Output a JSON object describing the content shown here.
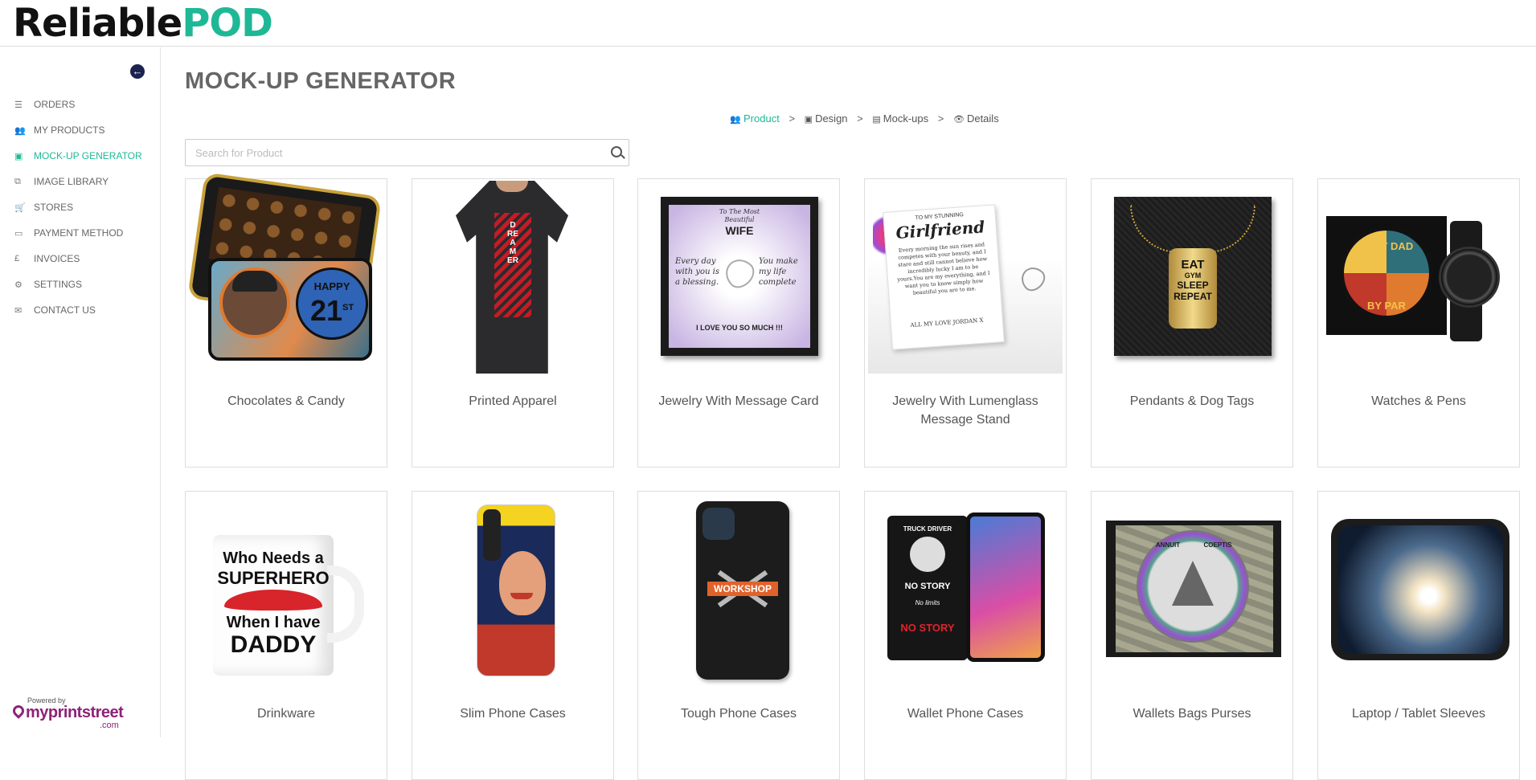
{
  "brand": {
    "part1": "Reliable",
    "part2": "POD"
  },
  "sidebar": {
    "items": [
      {
        "label": "ORDERS",
        "icon": "list-icon",
        "glyph": "☰",
        "active": false
      },
      {
        "label": "MY PRODUCTS",
        "icon": "users-icon",
        "glyph": "👥",
        "active": false
      },
      {
        "label": "MOCK-UP GENERATOR",
        "icon": "image-icon",
        "glyph": "▣",
        "active": true
      },
      {
        "label": "IMAGE LIBRARY",
        "icon": "copy-icon",
        "glyph": "⧉",
        "active": false
      },
      {
        "label": "STORES",
        "icon": "cart-icon",
        "glyph": "🛒",
        "active": false
      },
      {
        "label": "PAYMENT METHOD",
        "icon": "credit-card-icon",
        "glyph": "▭",
        "active": false
      },
      {
        "label": "INVOICES",
        "icon": "pound-icon",
        "glyph": "£",
        "active": false
      },
      {
        "label": "SETTINGS",
        "icon": "gear-icon",
        "glyph": "⚙",
        "active": false
      },
      {
        "label": "CONTACT US",
        "icon": "envelope-icon",
        "glyph": "✉",
        "active": false
      }
    ],
    "powered_by": "Powered by",
    "powered_brand": "myprintstreet",
    "powered_tld": ".com"
  },
  "main": {
    "title": "MOCK-UP GENERATOR",
    "breadcrumb": [
      {
        "label": "Product",
        "icon": "users-icon",
        "glyph": "👥",
        "active": true
      },
      {
        "label": "Design",
        "icon": "image-icon",
        "glyph": "▣",
        "active": false
      },
      {
        "label": "Mock-ups",
        "icon": "file-image-icon",
        "glyph": "▤",
        "active": false
      },
      {
        "label": "Details",
        "icon": "eye-icon",
        "glyph": "👁",
        "active": false
      }
    ],
    "search_placeholder": "Search for Product",
    "products": [
      {
        "label": "Chocolates & Candy",
        "art": {
          "top": "HAPPY",
          "num": "21",
          "sup": "ST"
        }
      },
      {
        "label": "Printed Apparel",
        "art": {
          "word": "DREAMER"
        }
      },
      {
        "label": "Jewelry With Message Card",
        "art": {
          "l1": "To The Most",
          "l2": "Beautiful",
          "l3": "WIFE",
          "left": "Every day with you is a blessing.",
          "right": "You make my life complete",
          "bottom": "I LOVE YOU SO MUCH !!!"
        }
      },
      {
        "label": "Jewelry With Lumenglass Message Stand",
        "art": {
          "l1": "TO MY STUNNING",
          "l2": "Girlfriend",
          "body": "Every morning the sun rises and competes with your beauty, and I stare and still cannot believe how incredibly lucky I am to be yours.You are my everything, and I want you to know simply how beautiful you are to me.",
          "sign": "ALL MY LOVE JORDAN X"
        }
      },
      {
        "label": "Pendants & Dog Tags",
        "art": {
          "l1": "EAT",
          "l2": "GYM",
          "l3": "SLEEP",
          "l4": "REPEAT"
        }
      },
      {
        "label": "Watches & Pens",
        "art": {
          "l1": "BEST DAD",
          "l2": "BY PAR"
        }
      },
      {
        "label": "Drinkware",
        "art": {
          "l1": "Who Needs a",
          "l2": "SUPERHERO",
          "l3": "When I have",
          "l4": "DADDY"
        }
      },
      {
        "label": "Slim Phone Cases",
        "art": {}
      },
      {
        "label": "Tough Phone Cases",
        "art": {
          "l1": "WORKSHOP"
        }
      },
      {
        "label": "Wallet Phone Cases",
        "art": {
          "l1": "TRUCK DRIVER",
          "l2": "NO STORY",
          "l3": "No limits",
          "l4": "NO STORY"
        }
      },
      {
        "label": "Wallets Bags Purses",
        "art": {
          "l1": "ANNUIT",
          "l2": "COEPTIS"
        }
      },
      {
        "label": "Laptop / Tablet Sleeves",
        "art": {}
      }
    ]
  },
  "colors": {
    "accent": "#1fb896",
    "brand_dark": "#111111",
    "nav_text": "#666666",
    "powered": "#8e2278"
  }
}
